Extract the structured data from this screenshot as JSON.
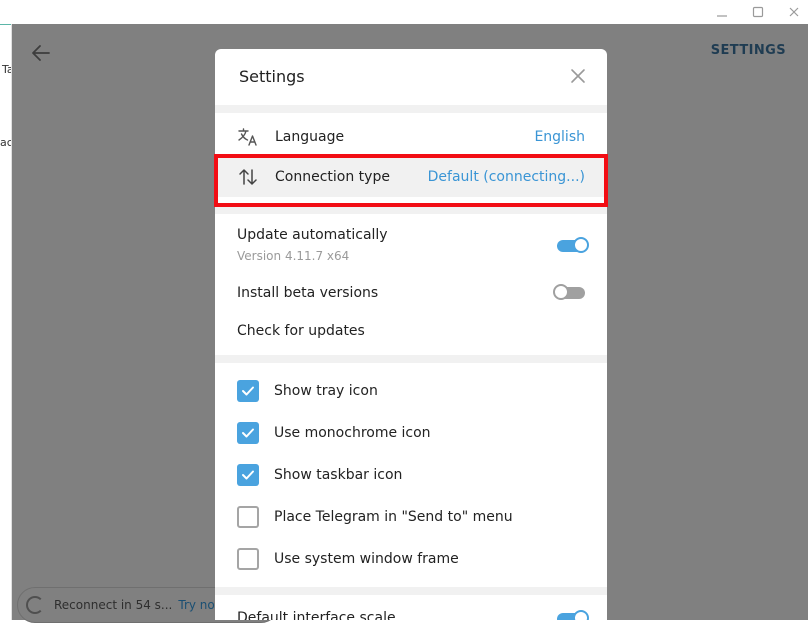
{
  "window": {
    "minimize_icon": "minimize-icon",
    "maximize_icon": "maximize-icon",
    "close_icon": "close-icon"
  },
  "left_strip": {
    "fragment_1": "Ta",
    "fragment_2": "ac"
  },
  "background": {
    "page_heading": "SETTINGS",
    "reconnect_text": "Reconnect in 54 s...",
    "try_now": "Try now"
  },
  "dialog": {
    "title": "Settings",
    "language": {
      "label": "Language",
      "value": "English",
      "icon": "translate-icon"
    },
    "connection": {
      "label": "Connection type",
      "value": "Default (connecting...)",
      "icon": "arrows-up-down-icon"
    },
    "update_auto": {
      "label": "Update automatically",
      "version": "Version 4.11.7 x64",
      "enabled": true
    },
    "beta": {
      "label": "Install beta versions",
      "enabled": false
    },
    "check_updates": "Check for updates",
    "checkboxes": [
      {
        "label": "Show tray icon",
        "checked": true
      },
      {
        "label": "Use monochrome icon",
        "checked": true
      },
      {
        "label": "Show taskbar icon",
        "checked": true
      },
      {
        "label": "Place Telegram in \"Send to\" menu",
        "checked": false
      },
      {
        "label": "Use system window frame",
        "checked": false
      }
    ],
    "interface_scale": {
      "label": "Default interface scale",
      "enabled": true
    }
  },
  "colors": {
    "accent": "#4aa3df",
    "link": "#3a95d5",
    "highlight_border": "#f20d14",
    "overlay": "#808080"
  }
}
